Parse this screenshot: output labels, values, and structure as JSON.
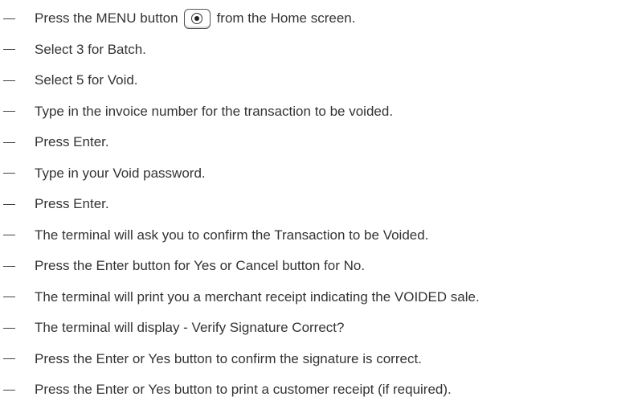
{
  "steps": [
    {
      "before": "Press the MENU button",
      "icon": "menu-button-icon",
      "after": "from the Home screen."
    },
    {
      "text": "Select 3 for Batch."
    },
    {
      "text": "Select 5 for Void."
    },
    {
      "text": "Type in the invoice number for the transaction to be voided."
    },
    {
      "text": "Press Enter."
    },
    {
      "text": "Type in your Void password."
    },
    {
      "text": "Press Enter."
    },
    {
      "text": "The terminal will ask you to confirm the Transaction to be Voided."
    },
    {
      "text": "Press the Enter button for Yes or Cancel button for No."
    },
    {
      "text": "The terminal will print you a merchant receipt indicating the VOIDED sale."
    },
    {
      "text": "The terminal will display - Verify Signature Correct?"
    },
    {
      "text": "Press the Enter or Yes button to confirm the signature is correct."
    },
    {
      "text": "Press the Enter or Yes button to print a customer receipt (if required)."
    }
  ]
}
